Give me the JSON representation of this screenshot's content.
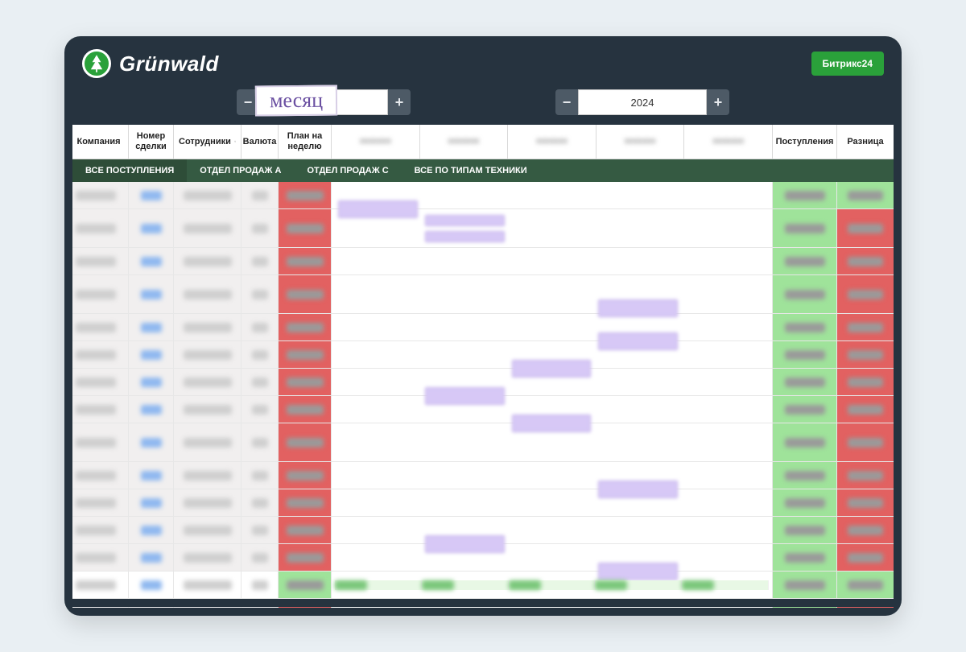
{
  "brand": {
    "name": "Grünwald"
  },
  "header": {
    "bitrix_label": "Битрикс24"
  },
  "period": {
    "month_label": "месяц",
    "year_value": "2024",
    "minus": "−",
    "plus": "+"
  },
  "columns": {
    "company": "Компания",
    "deal": "Номер сделки",
    "staff": "Сотрудники",
    "currency": "Валюта",
    "plan": "План на неделю",
    "incoming": "Поступления",
    "diff": "Разница"
  },
  "tabs": [
    "ВСЕ ПОСТУПЛЕНИЯ",
    "ОТДЕЛ ПРОДАЖ А",
    "ОТДЕЛ ПРОДАЖ С",
    "ВСЕ ПО ТИПАМ ТЕХНИКИ"
  ],
  "week_count": 5,
  "rows": [
    {
      "tall": false,
      "chips": [
        0
      ],
      "diff_green": true
    },
    {
      "tall": true,
      "chips": [
        1,
        1
      ],
      "diff_green": false
    },
    {
      "tall": false,
      "chips": [],
      "diff_green": false
    },
    {
      "tall": true,
      "chips": [
        3
      ],
      "diff_green": false
    },
    {
      "tall": false,
      "chips": [
        3
      ],
      "diff_green": false
    },
    {
      "tall": false,
      "chips": [
        2
      ],
      "diff_green": false
    },
    {
      "tall": false,
      "chips": [
        1
      ],
      "diff_green": false
    },
    {
      "tall": false,
      "chips": [
        2
      ],
      "diff_green": false
    },
    {
      "tall": true,
      "chips": [],
      "diff_green": false
    },
    {
      "tall": false,
      "chips": [
        3
      ],
      "diff_green": false
    },
    {
      "tall": false,
      "chips": [],
      "diff_green": false
    },
    {
      "tall": false,
      "chips": [
        1
      ],
      "diff_green": false
    },
    {
      "tall": false,
      "chips": [
        3
      ],
      "diff_green": false
    }
  ]
}
